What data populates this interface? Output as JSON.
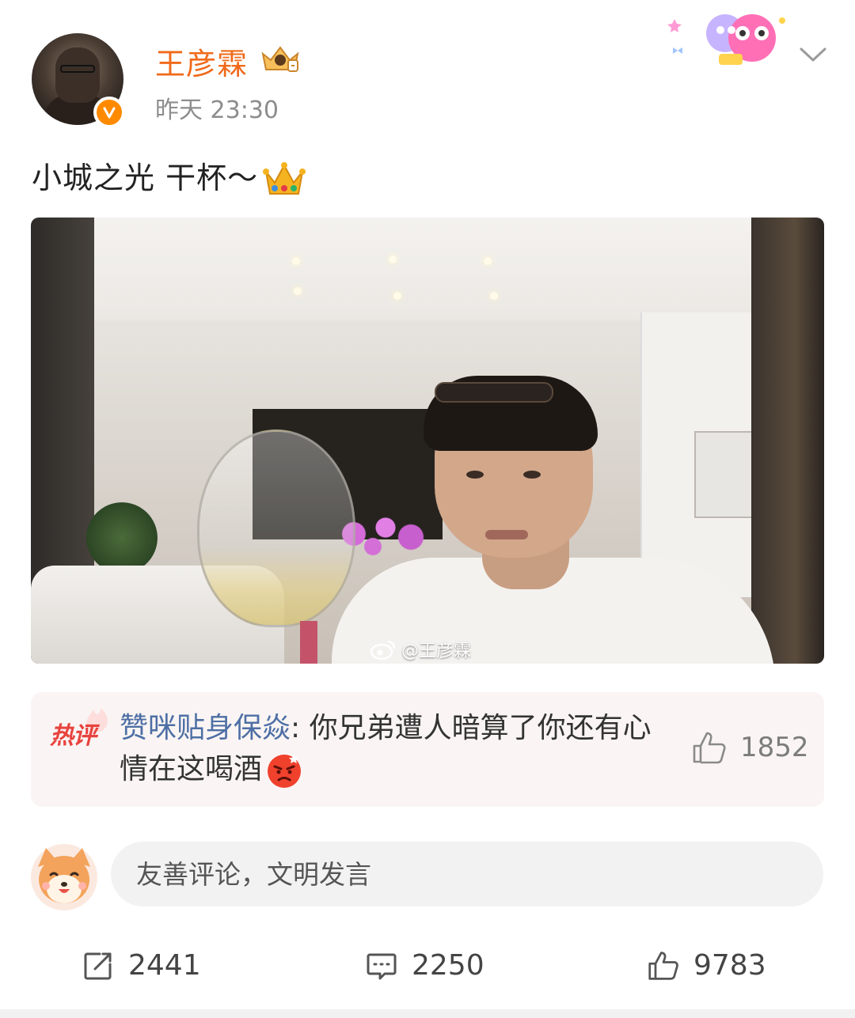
{
  "post": {
    "username": "王彦霖",
    "time": "昨天 23:30",
    "text": "小城之光 干杯～",
    "video_watermark": "@王彦霖"
  },
  "hot_comment": {
    "tag": "热评",
    "author": "赞咪贴身保焱",
    "separator": ": ",
    "text": "你兄弟遭人暗算了你还有心情在这喝酒",
    "likes": "1852"
  },
  "comment_input": {
    "placeholder": "友善评论，文明发言"
  },
  "actions": {
    "repost_count": "2441",
    "comment_count": "2250",
    "like_count": "9783"
  },
  "colors": {
    "username": "#f06a1a",
    "comment_author": "#4e6fa5",
    "hot_tag": "#e8433e",
    "verify_badge": "#ff8a00"
  },
  "icons": [
    "verified-badge-icon",
    "vip-crown-icon",
    "chevron-down-icon",
    "crown-emoji-icon",
    "weibo-logo-icon",
    "flame-icon",
    "angry-emoji-icon",
    "thumbs-up-icon",
    "repost-icon",
    "comment-icon"
  ]
}
